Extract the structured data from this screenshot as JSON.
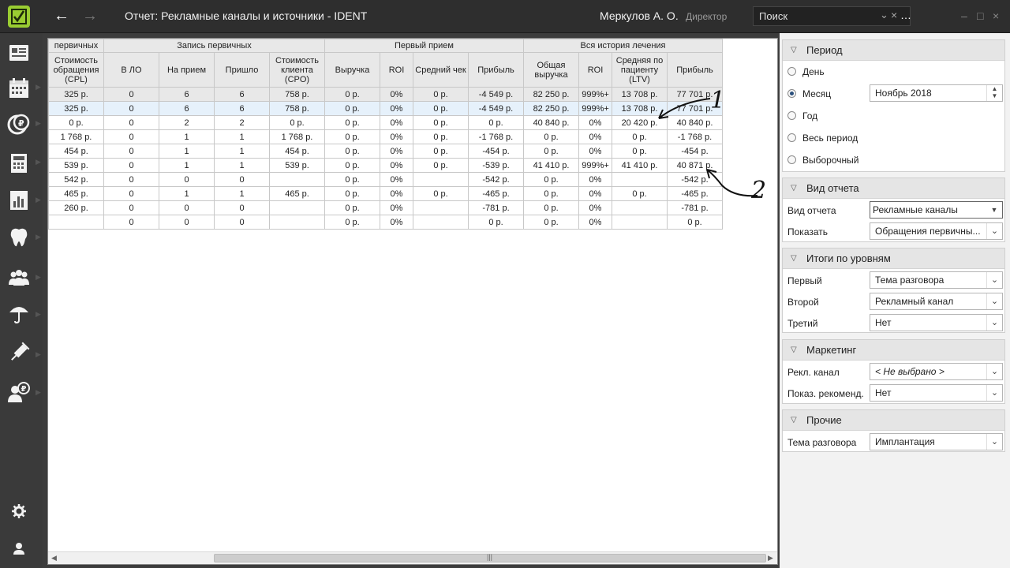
{
  "titlebar": {
    "title": "Отчет: Рекламные каналы и источники - IDENT",
    "user": "Меркулов А. О.",
    "role": "Директор",
    "search_placeholder": "Поиск"
  },
  "sidebar": {
    "items": [
      "card-icon",
      "calendar-icon",
      "ruble-icon",
      "calculator-icon",
      "report-icon",
      "tooth-icon",
      "patients-icon",
      "umbrella-icon",
      "syringe-icon",
      "ruble-person-icon"
    ],
    "bottom": [
      "gear-icon",
      "user-icon"
    ]
  },
  "grid": {
    "group_headers": [
      "первичных",
      "Запись первичных",
      "Первый прием",
      "Вся история лечения"
    ],
    "columns": [
      "Стоимость обращения (CPL)",
      "В ЛО",
      "На прием",
      "Пришло",
      "Стоимость клиента (CPO)",
      "Выручка",
      "ROI",
      "Средний чек",
      "Прибыль",
      "Общая выручка",
      "ROI",
      "Средняя по пациенту (LTV)",
      "Прибыль"
    ],
    "rows": [
      [
        "325 р.",
        "0",
        "6",
        "6",
        "758 р.",
        "0 р.",
        "0%",
        "0 р.",
        "-4 549 р.",
        "82 250 р.",
        "999%+",
        "13 708 р.",
        "77 701 р."
      ],
      [
        "325 р.",
        "0",
        "6",
        "6",
        "758 р.",
        "0 р.",
        "0%",
        "0 р.",
        "-4 549 р.",
        "82 250 р.",
        "999%+",
        "13 708 р.",
        "77 701 р."
      ],
      [
        "0 р.",
        "0",
        "2",
        "2",
        "0 р.",
        "0 р.",
        "0%",
        "0 р.",
        "0 р.",
        "40 840 р.",
        "0%",
        "20 420 р.",
        "40 840 р."
      ],
      [
        "1 768 р.",
        "0",
        "1",
        "1",
        "1 768 р.",
        "0 р.",
        "0%",
        "0 р.",
        "-1 768 р.",
        "0 р.",
        "0%",
        "0 р.",
        "-1 768 р."
      ],
      [
        "454 р.",
        "0",
        "1",
        "1",
        "454 р.",
        "0 р.",
        "0%",
        "0 р.",
        "-454 р.",
        "0 р.",
        "0%",
        "0 р.",
        "-454 р."
      ],
      [
        "539 р.",
        "0",
        "1",
        "1",
        "539 р.",
        "0 р.",
        "0%",
        "0 р.",
        "-539 р.",
        "41 410 р.",
        "999%+",
        "41 410 р.",
        "40 871 р."
      ],
      [
        "542 р.",
        "0",
        "0",
        "0",
        "",
        "0 р.",
        "0%",
        "",
        "-542 р.",
        "0 р.",
        "0%",
        "",
        "-542 р."
      ],
      [
        "465 р.",
        "0",
        "1",
        "1",
        "465 р.",
        "0 р.",
        "0%",
        "0 р.",
        "-465 р.",
        "0 р.",
        "0%",
        "0 р.",
        "-465 р."
      ],
      [
        "260 р.",
        "0",
        "0",
        "0",
        "",
        "0 р.",
        "0%",
        "",
        "-781 р.",
        "0 р.",
        "0%",
        "",
        "-781 р."
      ],
      [
        "",
        "0",
        "0",
        "0",
        "",
        "0 р.",
        "0%",
        "",
        "0 р.",
        "0 р.",
        "0%",
        "",
        "0 р."
      ]
    ]
  },
  "annotations": [
    "1",
    "2"
  ],
  "panel": {
    "period": {
      "title": "Период",
      "options": [
        "День",
        "Месяц",
        "Год",
        "Весь период",
        "Выборочный"
      ],
      "selected_index": 1,
      "month_value": "Ноябрь  2018"
    },
    "report_view": {
      "title": "Вид отчета",
      "fields": [
        {
          "label": "Вид отчета",
          "value": "Рекламные каналы"
        },
        {
          "label": "Показать",
          "value": "Обращения первичны..."
        }
      ]
    },
    "levels": {
      "title": "Итоги по уровням",
      "fields": [
        {
          "label": "Первый",
          "value": "Тема разговора"
        },
        {
          "label": "Второй",
          "value": "Рекламный канал"
        },
        {
          "label": "Третий",
          "value": "Нет"
        }
      ]
    },
    "marketing": {
      "title": "Маркетинг",
      "fields": [
        {
          "label": "Рекл. канал",
          "value": "< Не выбрано >"
        },
        {
          "label": "Показ. рекоменд.",
          "value": "Нет"
        }
      ]
    },
    "other": {
      "title": "Прочие",
      "fields": [
        {
          "label": "Тема разговора",
          "value": "Имплантация"
        }
      ]
    }
  },
  "colors": {
    "logo_green": "#9acd32",
    "titlebar_bg": "#2e2e2e",
    "sidebar_bg": "#3a3a3a",
    "selected_row": "#e6f1fb"
  }
}
